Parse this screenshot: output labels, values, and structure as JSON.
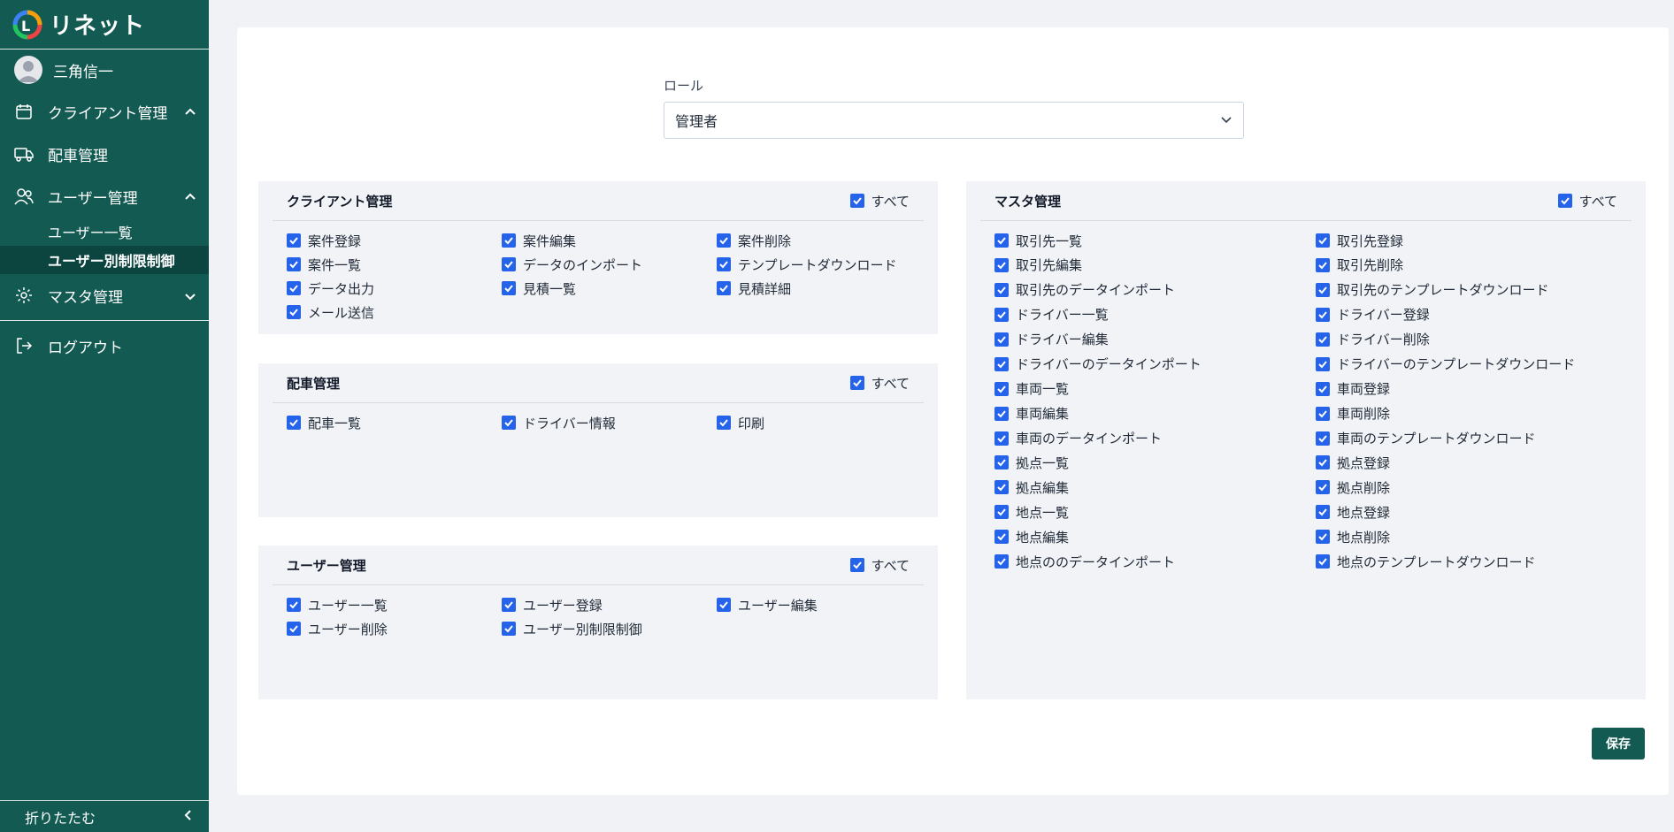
{
  "brand": {
    "name": "リネット",
    "logo_icon": "brand-logo-icon"
  },
  "user": {
    "name": "三角信一"
  },
  "nav": {
    "client": "クライアント管理",
    "dispatch": "配車管理",
    "user": "ユーザー管理",
    "user_sub": [
      "ユーザー一覧",
      "ユーザー別制限制御"
    ],
    "master": "マスタ管理",
    "logout": "ログアウト",
    "collapse": "折りたたむ"
  },
  "role": {
    "label": "ロール",
    "value": "管理者"
  },
  "all_label": "すべて",
  "panels": {
    "client": {
      "title": "クライアント管理",
      "items": [
        "案件登録",
        "案件編集",
        "案件削除",
        "案件一覧",
        "データのインポート",
        "テンプレートダウンロード",
        "データ出力",
        "見積一覧",
        "見積詳細",
        "メール送信"
      ]
    },
    "dispatch": {
      "title": "配車管理",
      "items": [
        "配車一覧",
        "ドライバー情報",
        "印刷"
      ]
    },
    "users": {
      "title": "ユーザー管理",
      "items": [
        "ユーザー一覧",
        "ユーザー登録",
        "ユーザー編集",
        "ユーザー削除",
        "ユーザー別制限制御"
      ]
    },
    "master": {
      "title": "マスタ管理",
      "items": [
        "取引先一覧",
        "取引先登録",
        "取引先編集",
        "取引先削除",
        "取引先のデータインポート",
        "取引先のテンプレートダウンロード",
        "ドライバー一覧",
        "ドライバー登録",
        "ドライバー編集",
        "ドライバー削除",
        "ドライバーのデータインポート",
        "ドライバーのテンプレートダウンロード",
        "車両一覧",
        "車両登録",
        "車両編集",
        "車両削除",
        "車両のデータインポート",
        "車両のテンプレートダウンロード",
        "拠点一覧",
        "拠点登録",
        "拠点編集",
        "拠点削除",
        "地点一覧",
        "地点登録",
        "地点編集",
        "地点削除",
        "地点ののデータインポート",
        "地点のテンプレートダウンロード"
      ]
    }
  },
  "save_label": "保存",
  "colors": {
    "sidebar": "#135a53",
    "checkbox": "#2563eb",
    "panel_bg": "#f1f3f6"
  }
}
